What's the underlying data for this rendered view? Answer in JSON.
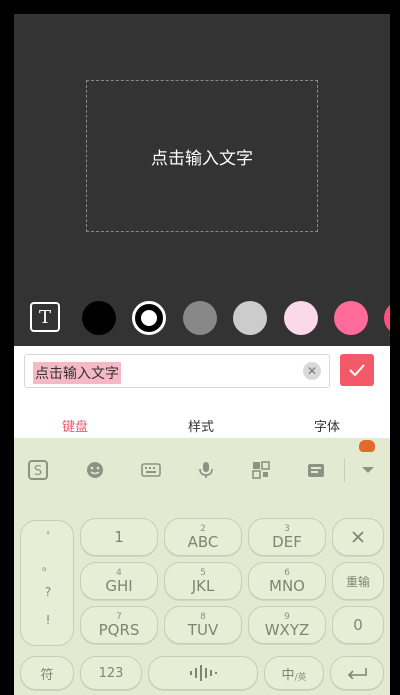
{
  "canvas": {
    "placeholder": "点击输入文字",
    "tool_label": "T"
  },
  "colors": {
    "swatches": [
      "#000000",
      "#ffffff",
      "#888888",
      "#cccccc",
      "#fbd9e6",
      "#ff6b9a",
      "#ff4f86"
    ],
    "selected_index": 1
  },
  "input": {
    "value": "点击输入文字",
    "clear_symbol": "✕"
  },
  "tabs": [
    {
      "label": "键盘"
    },
    {
      "label": "样式"
    },
    {
      "label": "字体"
    }
  ],
  "keyboard": {
    "toolbar_icons": [
      "sogou-logo-icon",
      "emoji-icon",
      "keyboard-icon",
      "microphone-icon",
      "qr-code-icon",
      "clipboard-icon",
      "collapse-arrow-icon"
    ],
    "punct": [
      "'",
      "。",
      "?",
      "!"
    ],
    "keys": {
      "k1": {
        "sub": "",
        "main": "1"
      },
      "k2": {
        "sub": "2",
        "main": "ABC"
      },
      "k3": {
        "sub": "3",
        "main": "DEF"
      },
      "k4": {
        "sub": "4",
        "main": "GHI"
      },
      "k5": {
        "sub": "5",
        "main": "JKL"
      },
      "k6": {
        "sub": "6",
        "main": "MNO"
      },
      "k7": {
        "sub": "7",
        "main": "PQRS"
      },
      "k8": {
        "sub": "8",
        "main": "TUV"
      },
      "k9": {
        "sub": "9",
        "main": "WXYZ"
      }
    },
    "reenter": "重输",
    "zero": "0",
    "symbol": "符",
    "num": "123",
    "lang_main": "中",
    "lang_sub": "/英"
  }
}
